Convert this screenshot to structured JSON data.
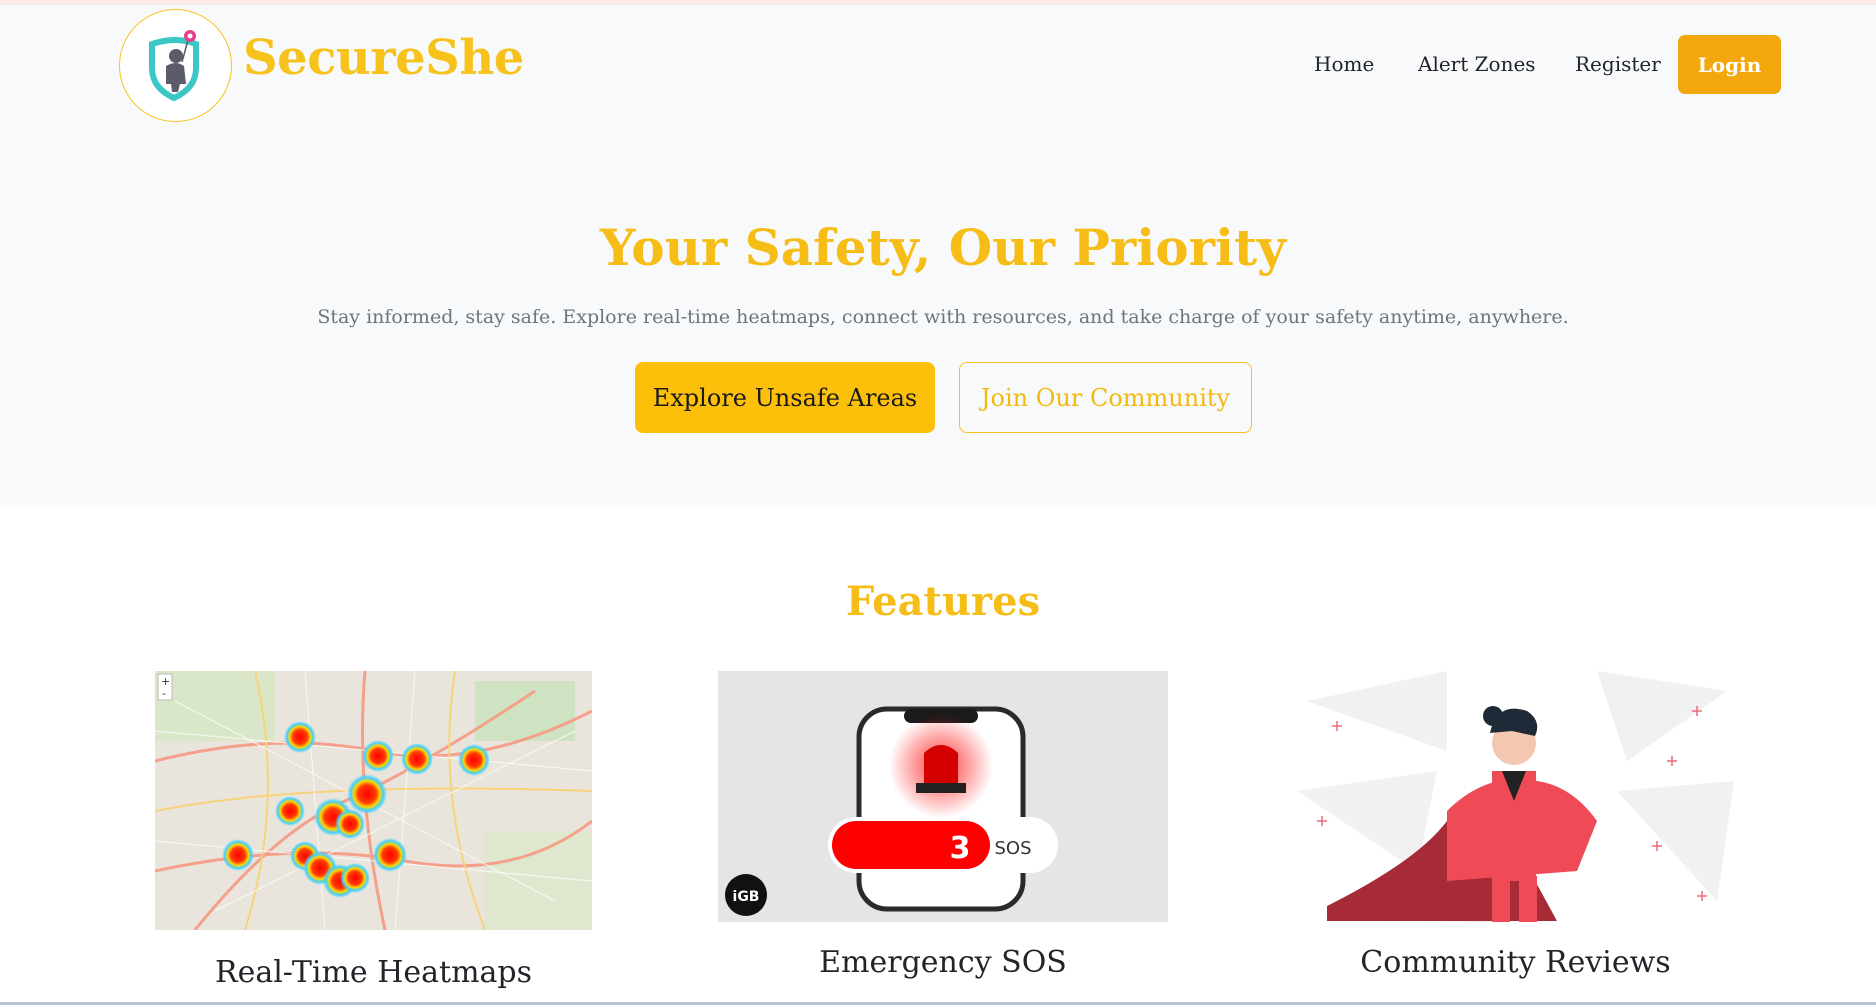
{
  "brand": {
    "name": "SecureShe"
  },
  "nav": {
    "items": [
      {
        "label": "Home"
      },
      {
        "label": "Alert Zones"
      },
      {
        "label": "Register"
      }
    ],
    "login_label": "Login"
  },
  "hero": {
    "title": "Your Safety, Our Priority",
    "subtitle": "Stay informed, stay safe. Explore real-time heatmaps, connect with resources, and take charge of your safety anytime, anywhere.",
    "primary_button": "Explore Unsafe Areas",
    "secondary_button": "Join Our Community"
  },
  "features": {
    "title": "Features",
    "cards": [
      {
        "title": "Real-Time Heatmaps"
      },
      {
        "title": "Emergency SOS",
        "sos_count": "3",
        "sos_label": "SOS",
        "badge": "iGB"
      },
      {
        "title": "Community Reviews"
      }
    ]
  },
  "colors": {
    "accent": "#f6c21b",
    "login": "#f2a80a",
    "sos_red": "#ff0000"
  }
}
